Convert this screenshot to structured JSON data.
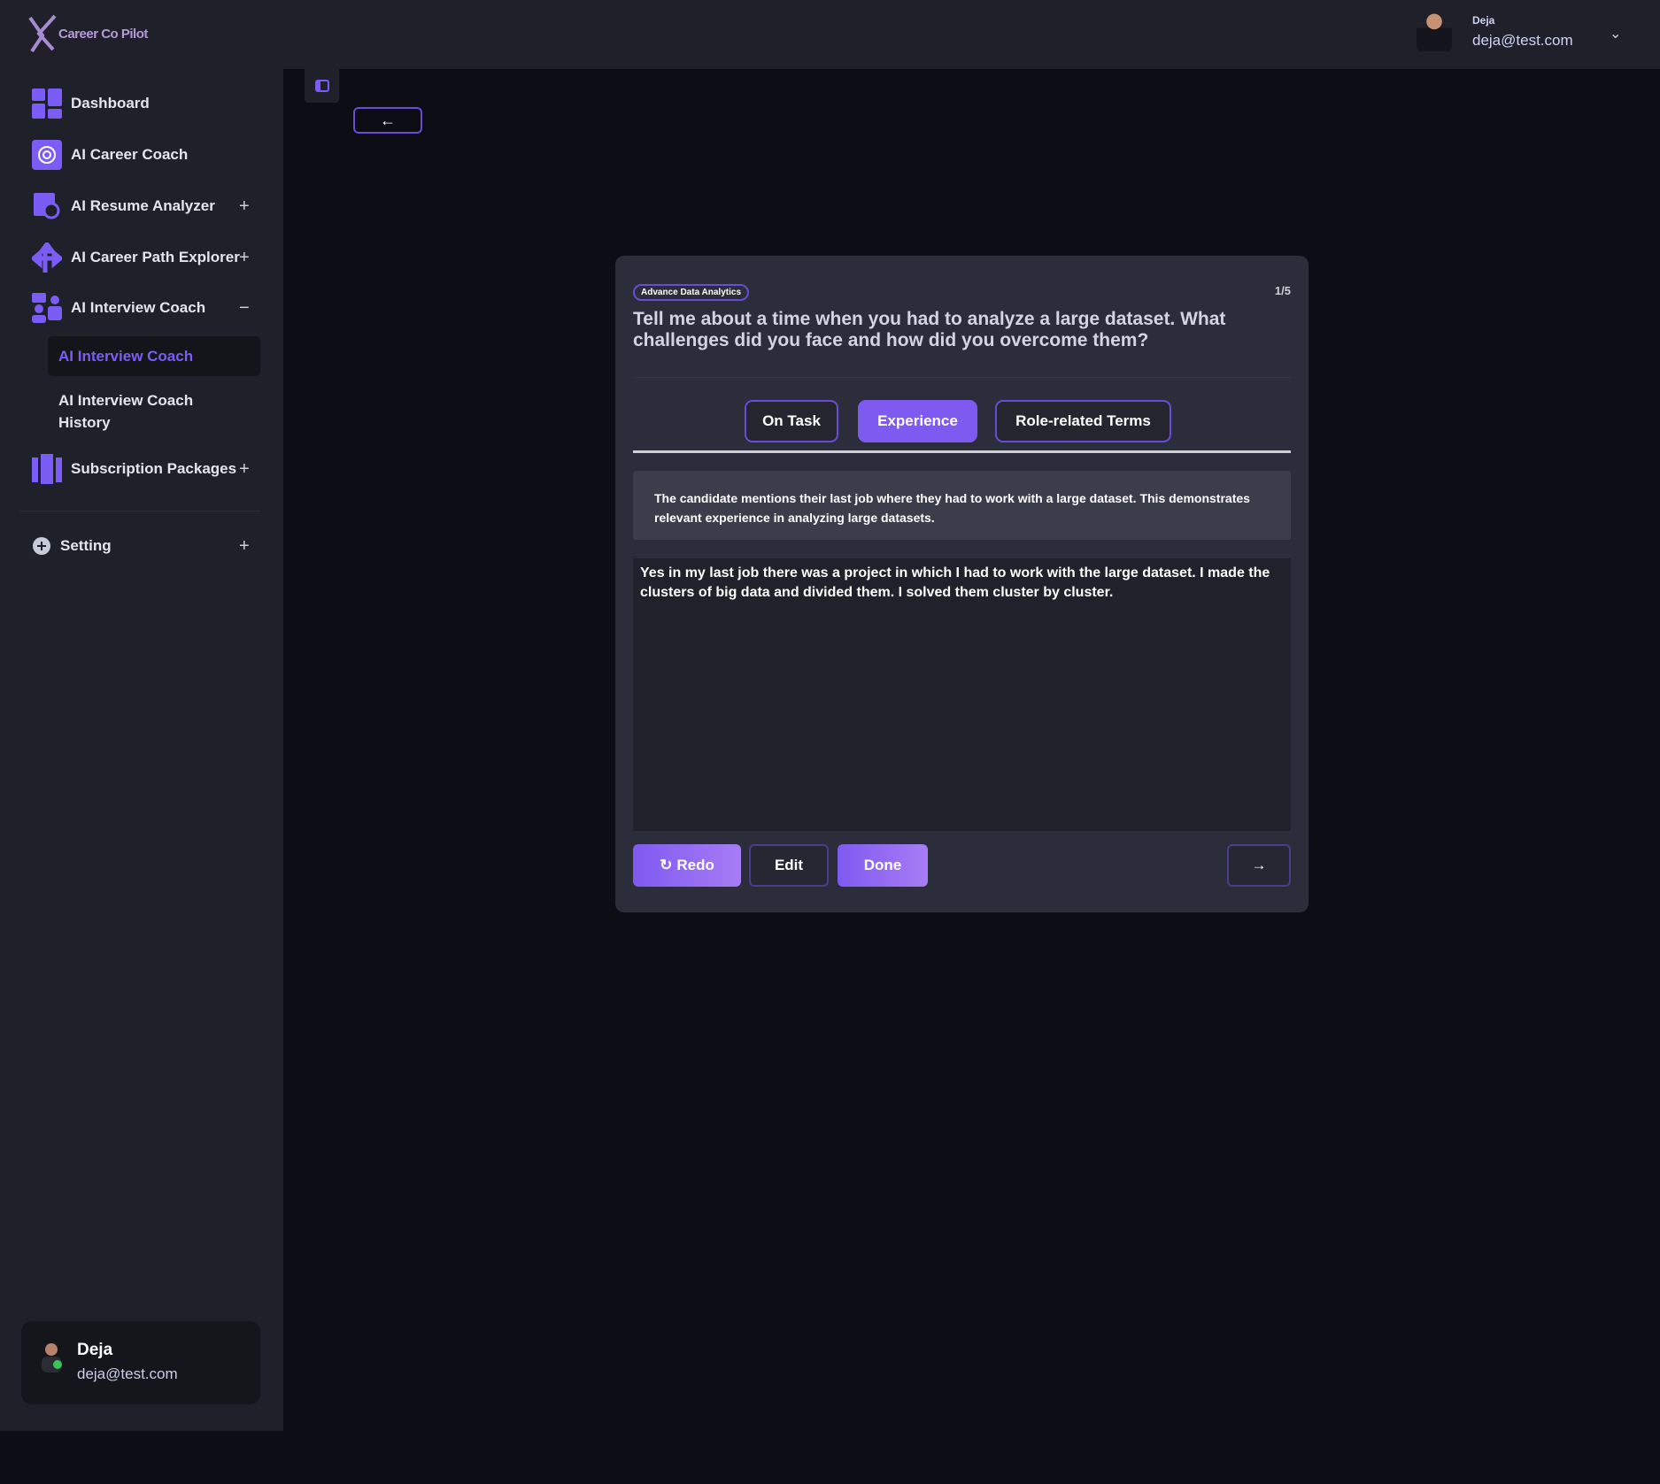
{
  "brand": {
    "name": "Career Co Pilot"
  },
  "header": {
    "user_name": "Deja",
    "user_email": "deja@test.com"
  },
  "sidebar": {
    "items": [
      {
        "label": "Dashboard",
        "icon": "dashboard-icon",
        "toggle": ""
      },
      {
        "label": "AI Career Coach",
        "icon": "openai-icon",
        "toggle": ""
      },
      {
        "label": "AI Resume Analyzer",
        "icon": "resume-analyzer-icon",
        "toggle": "+"
      },
      {
        "label": "AI Career Path Explorer",
        "icon": "signpost-icon",
        "toggle": "+"
      },
      {
        "label": "AI Interview Coach",
        "icon": "interview-icon",
        "toggle": "−"
      },
      {
        "label": "Subscription Packages",
        "icon": "packages-icon",
        "toggle": "+"
      },
      {
        "label": "Setting",
        "icon": "settings-icon",
        "toggle": "+"
      }
    ],
    "subitems": [
      {
        "label": "AI Interview Coach",
        "active": true
      },
      {
        "label": "AI Interview Coach History",
        "active": false
      }
    ],
    "user": {
      "name": "Deja",
      "email": "deja@test.com",
      "status": "online"
    }
  },
  "main": {
    "badge": "Advance Data Analytics",
    "progress": "1/5",
    "question": "Tell me about a time when you had to analyze a large dataset. What challenges did you face and how did you overcome them?",
    "tabs": [
      {
        "label": "On Task",
        "active": false
      },
      {
        "label": "Experience",
        "active": true
      },
      {
        "label": "Role-related Terms",
        "active": false
      }
    ],
    "feedback": "The candidate mentions their last job where they had to work with a large dataset. This demonstrates relevant experience in analyzing large datasets.",
    "answer": "Yes in my last job there was a project in which I had to work with the large dataset. I made the clusters of big data and divided them. I solved them cluster by cluster.",
    "buttons": {
      "redo": "Redo",
      "edit": "Edit",
      "done": "Done"
    }
  },
  "colors": {
    "accent": "#7f5af0",
    "background": "#0d0d16",
    "panel": "#1f212a",
    "card": "#2c2d3a"
  }
}
